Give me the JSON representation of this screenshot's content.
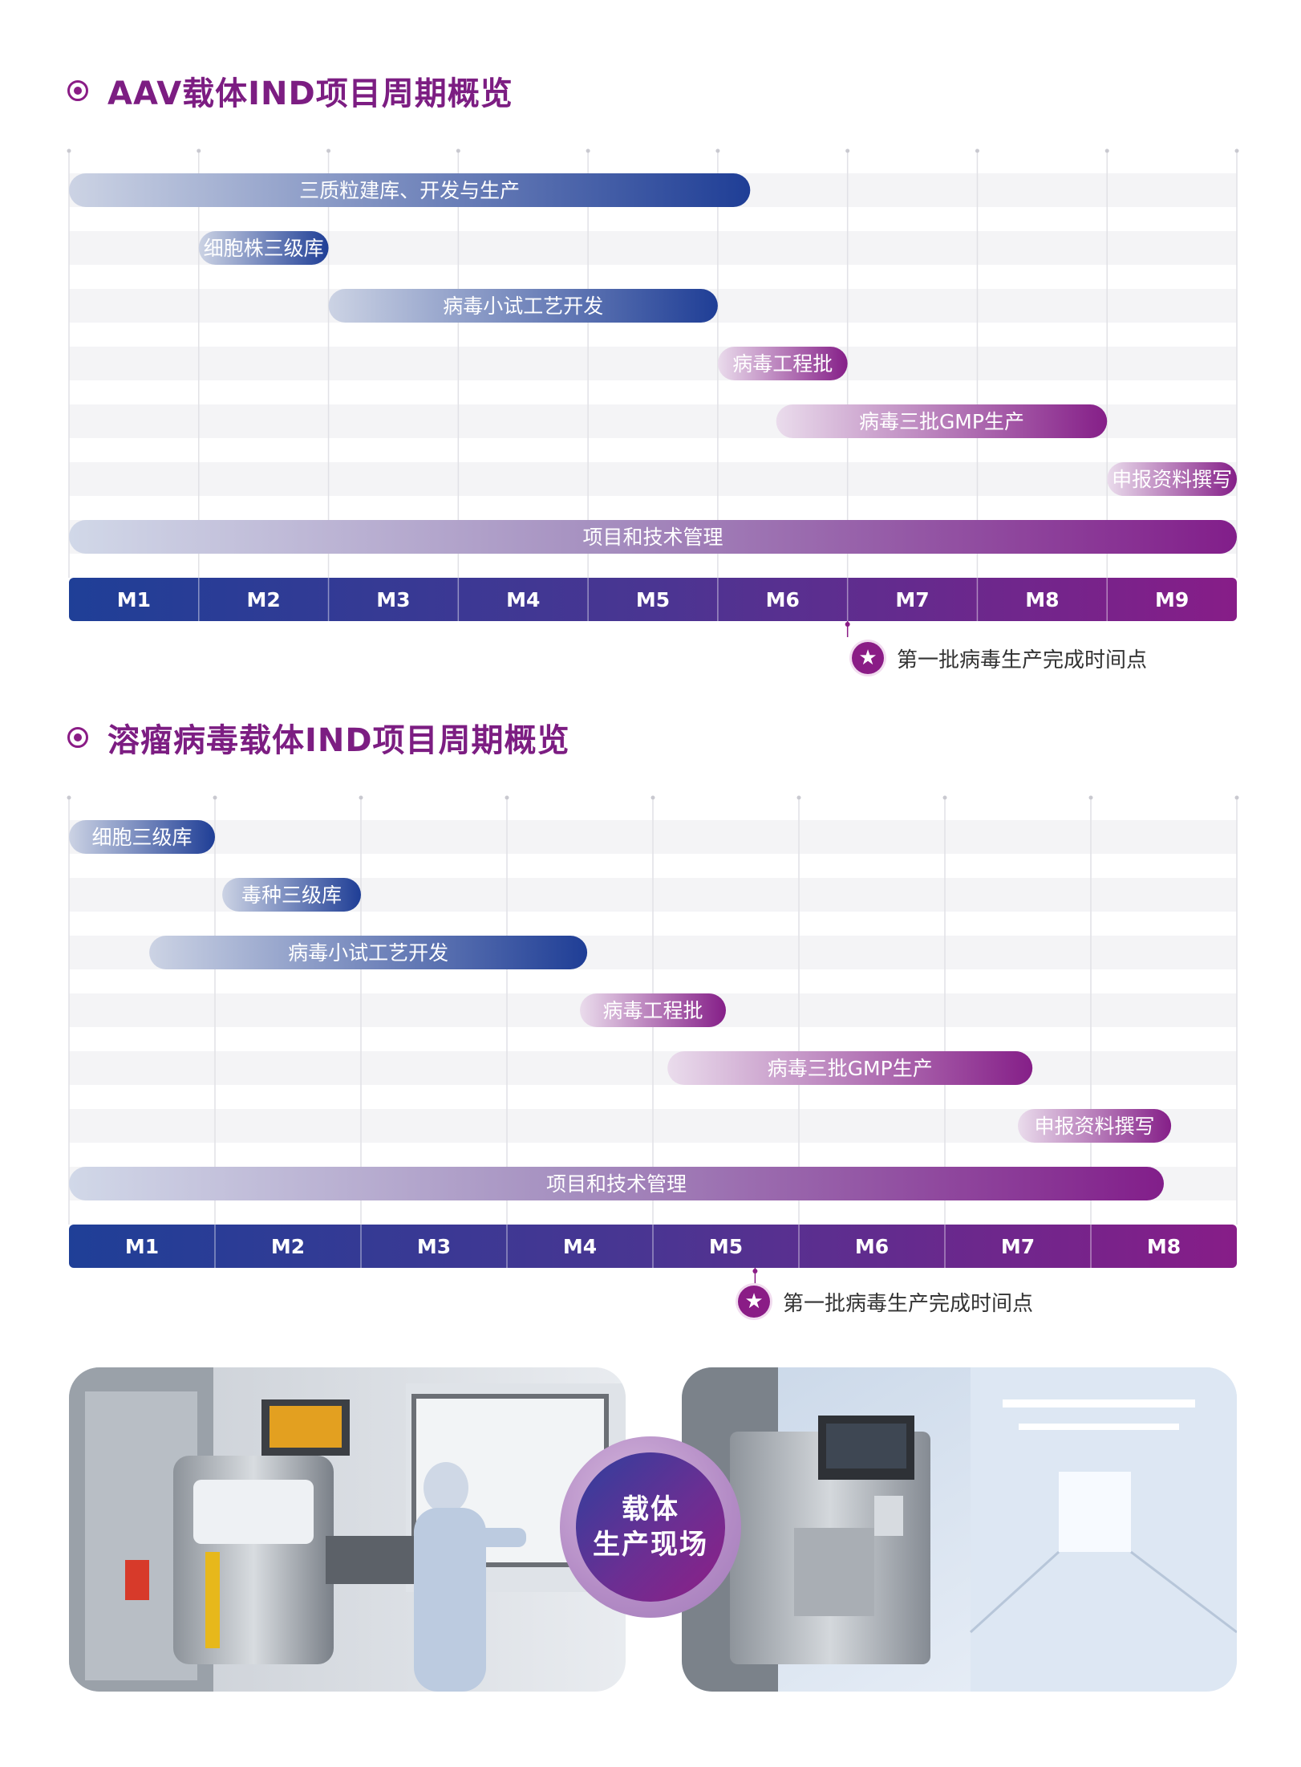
{
  "chart_data": [
    {
      "type": "gantt",
      "title": "AAV载体IND项目周期概览",
      "months": [
        "M1",
        "M2",
        "M3",
        "M4",
        "M5",
        "M6",
        "M7",
        "M8",
        "M9"
      ],
      "tasks": [
        {
          "label": "三质粒建库、开发与生产",
          "start": 0.0,
          "end": 5.25,
          "palette": "blue"
        },
        {
          "label": "细胞株三级库",
          "start": 1.0,
          "end": 2.0,
          "palette": "blue"
        },
        {
          "label": "病毒小试工艺开发",
          "start": 2.0,
          "end": 5.0,
          "palette": "blue"
        },
        {
          "label": "病毒工程批",
          "start": 5.0,
          "end": 6.0,
          "palette": "purple"
        },
        {
          "label": "病毒三批GMP生产",
          "start": 5.45,
          "end": 8.0,
          "palette": "purple"
        },
        {
          "label": "申报资料撰写",
          "start": 8.0,
          "end": 9.0,
          "palette": "purple"
        },
        {
          "label": "项目和技术管理",
          "start": 0.0,
          "end": 9.0,
          "palette": "full"
        }
      ],
      "milestone": {
        "label": "第一批病毒生产完成时间点",
        "at": 6.0
      }
    },
    {
      "type": "gantt",
      "title": "溶瘤病毒载体IND项目周期概览",
      "months": [
        "M1",
        "M2",
        "M3",
        "M4",
        "M5",
        "M6",
        "M7",
        "M8"
      ],
      "tasks": [
        {
          "label": "细胞三级库",
          "start": 0.0,
          "end": 1.0,
          "palette": "blue"
        },
        {
          "label": "毒种三级库",
          "start": 1.05,
          "end": 2.0,
          "palette": "blue"
        },
        {
          "label": "病毒小试工艺开发",
          "start": 0.55,
          "end": 3.55,
          "palette": "blue"
        },
        {
          "label": "病毒工程批",
          "start": 3.5,
          "end": 4.5,
          "palette": "purple"
        },
        {
          "label": "病毒三批GMP生产",
          "start": 4.1,
          "end": 6.6,
          "palette": "purple"
        },
        {
          "label": "申报资料撰写",
          "start": 6.5,
          "end": 7.55,
          "palette": "purple"
        },
        {
          "label": "项目和技术管理",
          "start": 0.0,
          "end": 7.5,
          "palette": "full"
        }
      ],
      "milestone": {
        "label": "第一批病毒生产完成时间点",
        "at": 4.7
      }
    }
  ],
  "section_titles": [
    "AAV载体IND项目周期概览",
    "溶瘤病毒载体IND项目周期概览"
  ],
  "center_badge": {
    "line1": "载体",
    "line2": "生产现场"
  },
  "colors": {
    "accent": "#8a1c86",
    "blue": "#1f3e96",
    "purple": "#851f88",
    "row": "#f4f4f6"
  }
}
